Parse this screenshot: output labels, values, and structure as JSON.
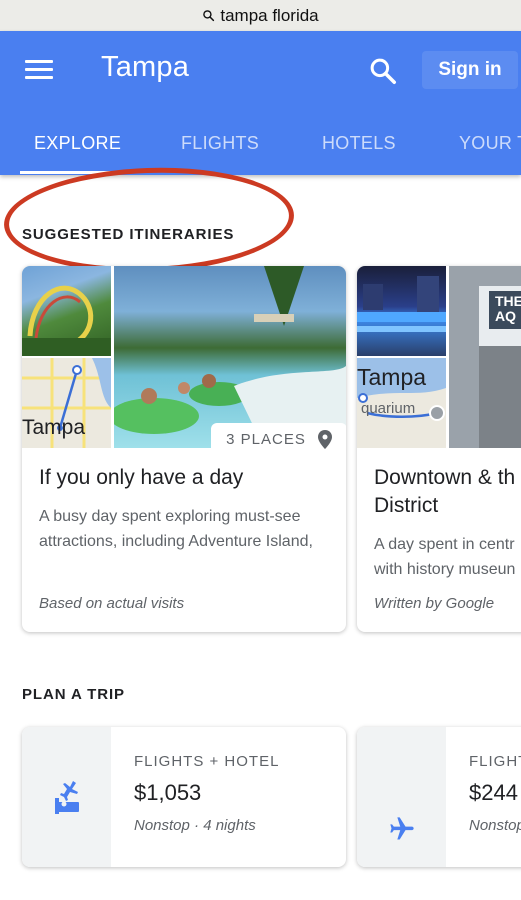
{
  "browser": {
    "url_text": "tampa florida"
  },
  "appbar": {
    "title": "Tampa",
    "signin_label": "Sign in",
    "tabs": [
      {
        "label": "EXPLORE",
        "active": true
      },
      {
        "label": "FLIGHTS",
        "active": false
      },
      {
        "label": "HOTELS",
        "active": false
      },
      {
        "label": "YOUR T",
        "active": false
      }
    ]
  },
  "itineraries": {
    "heading": "SUGGESTED ITINERARIES",
    "cards": [
      {
        "title_lines": [
          "If you only have a day"
        ],
        "description_lines": [
          "A busy day spent exploring must-see",
          "attractions, including Adventure Island,"
        ],
        "footer": "Based on actual visits",
        "places_badge": "3 PLACES",
        "map_label": "Tampa"
      },
      {
        "title_lines": [
          "Downtown & th",
          "District"
        ],
        "description_lines": [
          "A day spent in centr",
          "with history museun"
        ],
        "footer": "Written by Google",
        "map_label": "Tampa",
        "map_sublabel": "quarium",
        "photo_sign": "THE AQ"
      }
    ]
  },
  "plan": {
    "heading": "PLAN A TRIP",
    "cards": [
      {
        "kind": "FLIGHTS + HOTEL",
        "price": "$1,053",
        "detail": "Nonstop · 4 nights",
        "icon": "flight-hotel-icon"
      },
      {
        "kind": "FLIGHT",
        "price": "$244",
        "detail": "Nonstop",
        "icon": "airplane-icon"
      }
    ]
  },
  "colors": {
    "appbar": "#4a7ff0",
    "annotation": "#cc3a22",
    "icon_blue": "#4a7ff0"
  }
}
